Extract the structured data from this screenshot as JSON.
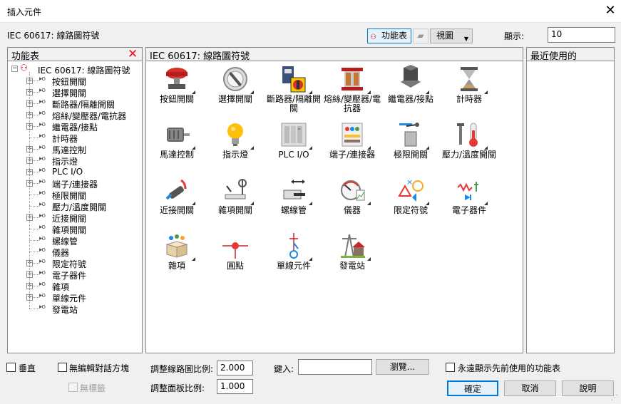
{
  "window": {
    "title": "插入元件"
  },
  "path_label": "IEC 60617: 線路圖符號",
  "toolbar": {
    "palette_label": "功能表",
    "view_label": "視圖",
    "display_label": "顯示:",
    "display_value": "10"
  },
  "left_panel": {
    "title": "功能表",
    "root": "IEC 60617: 線路圖符號",
    "items": [
      {
        "label": "按鈕開關",
        "expandable": true
      },
      {
        "label": "選擇開關",
        "expandable": true
      },
      {
        "label": "斷路器/隔離開關",
        "expandable": true
      },
      {
        "label": "熔絲/變壓器/電抗器",
        "expandable": true
      },
      {
        "label": "繼電器/接點",
        "expandable": true
      },
      {
        "label": "計時器",
        "expandable": false
      },
      {
        "label": "馬達控制",
        "expandable": true
      },
      {
        "label": "指示燈",
        "expandable": true
      },
      {
        "label": "PLC I/O",
        "expandable": true
      },
      {
        "label": "端子/連接器",
        "expandable": true
      },
      {
        "label": "極限開關",
        "expandable": false
      },
      {
        "label": "壓力/溫度開關",
        "expandable": false
      },
      {
        "label": "近接開關",
        "expandable": true
      },
      {
        "label": "雜項開關",
        "expandable": false
      },
      {
        "label": "螺線管",
        "expandable": false
      },
      {
        "label": "儀器",
        "expandable": false
      },
      {
        "label": "限定符號",
        "expandable": true
      },
      {
        "label": "電子器件",
        "expandable": true
      },
      {
        "label": "雜項",
        "expandable": true
      },
      {
        "label": "單線元件",
        "expandable": true
      },
      {
        "label": "發電站",
        "expandable": false
      }
    ]
  },
  "center_panel": {
    "title": "IEC 60617: 線路圖符號",
    "tiles": [
      {
        "label": "按鈕開關",
        "icon": "pushbutton-icon",
        "sub": true
      },
      {
        "label": "選擇開關",
        "icon": "selector-switch-icon",
        "sub": true
      },
      {
        "label": "斷路器/隔離開關",
        "icon": "breaker-icon",
        "sub": true
      },
      {
        "label": "熔絲/變壓器/電抗器",
        "icon": "transformer-icon",
        "sub": true
      },
      {
        "label": "繼電器/接點",
        "icon": "relay-icon",
        "sub": true
      },
      {
        "label": "計時器",
        "icon": "hourglass-icon",
        "sub": true
      },
      {
        "label": "馬達控制",
        "icon": "motor-icon",
        "sub": true
      },
      {
        "label": "指示燈",
        "icon": "lightbulb-icon",
        "sub": true
      },
      {
        "label": "PLC I/O",
        "icon": "plc-icon",
        "sub": true
      },
      {
        "label": "端子/連接器",
        "icon": "terminal-icon",
        "sub": true
      },
      {
        "label": "極限開關",
        "icon": "limit-switch-icon",
        "sub": true
      },
      {
        "label": "壓力/溫度開關",
        "icon": "thermometer-icon",
        "sub": true
      },
      {
        "label": "近接開關",
        "icon": "proximity-icon",
        "sub": true
      },
      {
        "label": "雜項開關",
        "icon": "misc-switch-icon",
        "sub": true
      },
      {
        "label": "螺線管",
        "icon": "solenoid-icon",
        "sub": true
      },
      {
        "label": "儀器",
        "icon": "gauge-icon",
        "sub": true
      },
      {
        "label": "限定符號",
        "icon": "qualifier-icon",
        "sub": true
      },
      {
        "label": "電子器件",
        "icon": "electronics-icon",
        "sub": true
      },
      {
        "label": "雜項",
        "icon": "misc-box-icon",
        "sub": true
      },
      {
        "label": "圓點",
        "icon": "dot-icon",
        "sub": false
      },
      {
        "label": "單線元件",
        "icon": "one-line-icon",
        "sub": true
      },
      {
        "label": "發電站",
        "icon": "power-station-icon",
        "sub": true
      }
    ]
  },
  "right_panel": {
    "title": "最近使用的"
  },
  "bottom": {
    "vertical_label": "垂直",
    "no_edit_label": "無編輯對話方塊",
    "no_tag_label": "無標籤",
    "scale_label": "調整線路圖比例:",
    "scale_value": "2.000",
    "panel_scale_label": "調整面板比例:",
    "panel_scale_value": "1.000",
    "type_it_label": "鍵入:",
    "type_it_value": "",
    "browse_label": "瀏覽...",
    "always_show_label": "永遠顯示先前使用的功能表",
    "ok_label": "確定",
    "cancel_label": "取消",
    "help_label": "說明"
  },
  "colors": {
    "accent": "#0078d7",
    "delete": "#e81123"
  }
}
